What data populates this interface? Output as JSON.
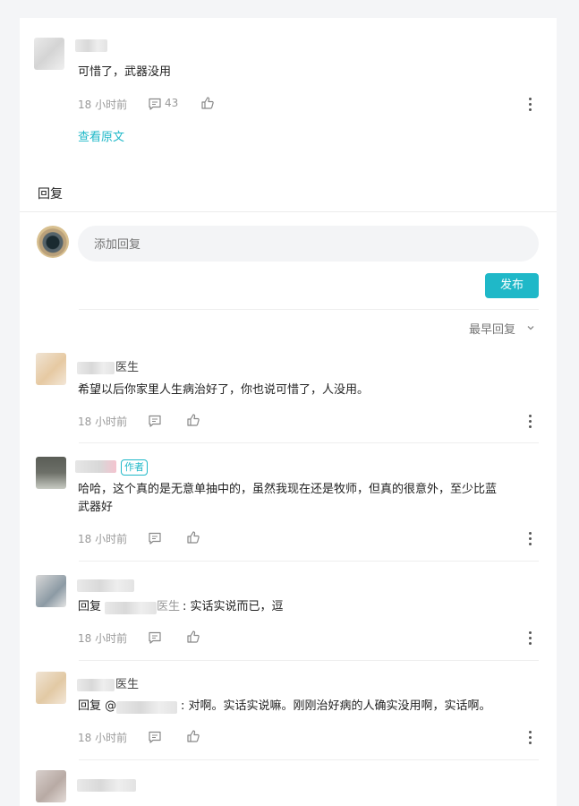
{
  "original": {
    "text": "可惜了，武器没用",
    "time": "18 小时前",
    "comment_count": "43",
    "view_original": "查看原文"
  },
  "reply_section": {
    "title": "回复",
    "placeholder": "添加回复",
    "publish_label": "发布",
    "sort_label": "最早回复"
  },
  "replies": [
    {
      "name_suffix": "医生",
      "text": "希望以后你家里人生病治好了，你也说可惜了，人没用。",
      "time": "18 小时前"
    },
    {
      "badge": "作者",
      "text_line1": "哈哈，这个真的是无意单抽中的，虽然我现在还是牧师，但真的很意外，至少比蓝",
      "text_line2": "武器好",
      "time": "18 小时前"
    },
    {
      "reply_prefix": "回复",
      "reply_to_suffix": "医生",
      "text": ": 实话实说而已，逗",
      "time": "18 小时前"
    },
    {
      "name_suffix": "医生",
      "reply_prefix": "回复 @",
      "text": ": 对啊。实话实说嘛。刚刚治好病的人确实没用啊，实话啊。",
      "time": "18 小时前"
    }
  ],
  "icons": {
    "comment": "comment-icon",
    "like": "thumbs-up-icon",
    "more": "more-vertical-icon",
    "chevron": "chevron-down-icon"
  },
  "colors": {
    "accent": "#1fb8c8",
    "link": "#1fb8c8"
  }
}
